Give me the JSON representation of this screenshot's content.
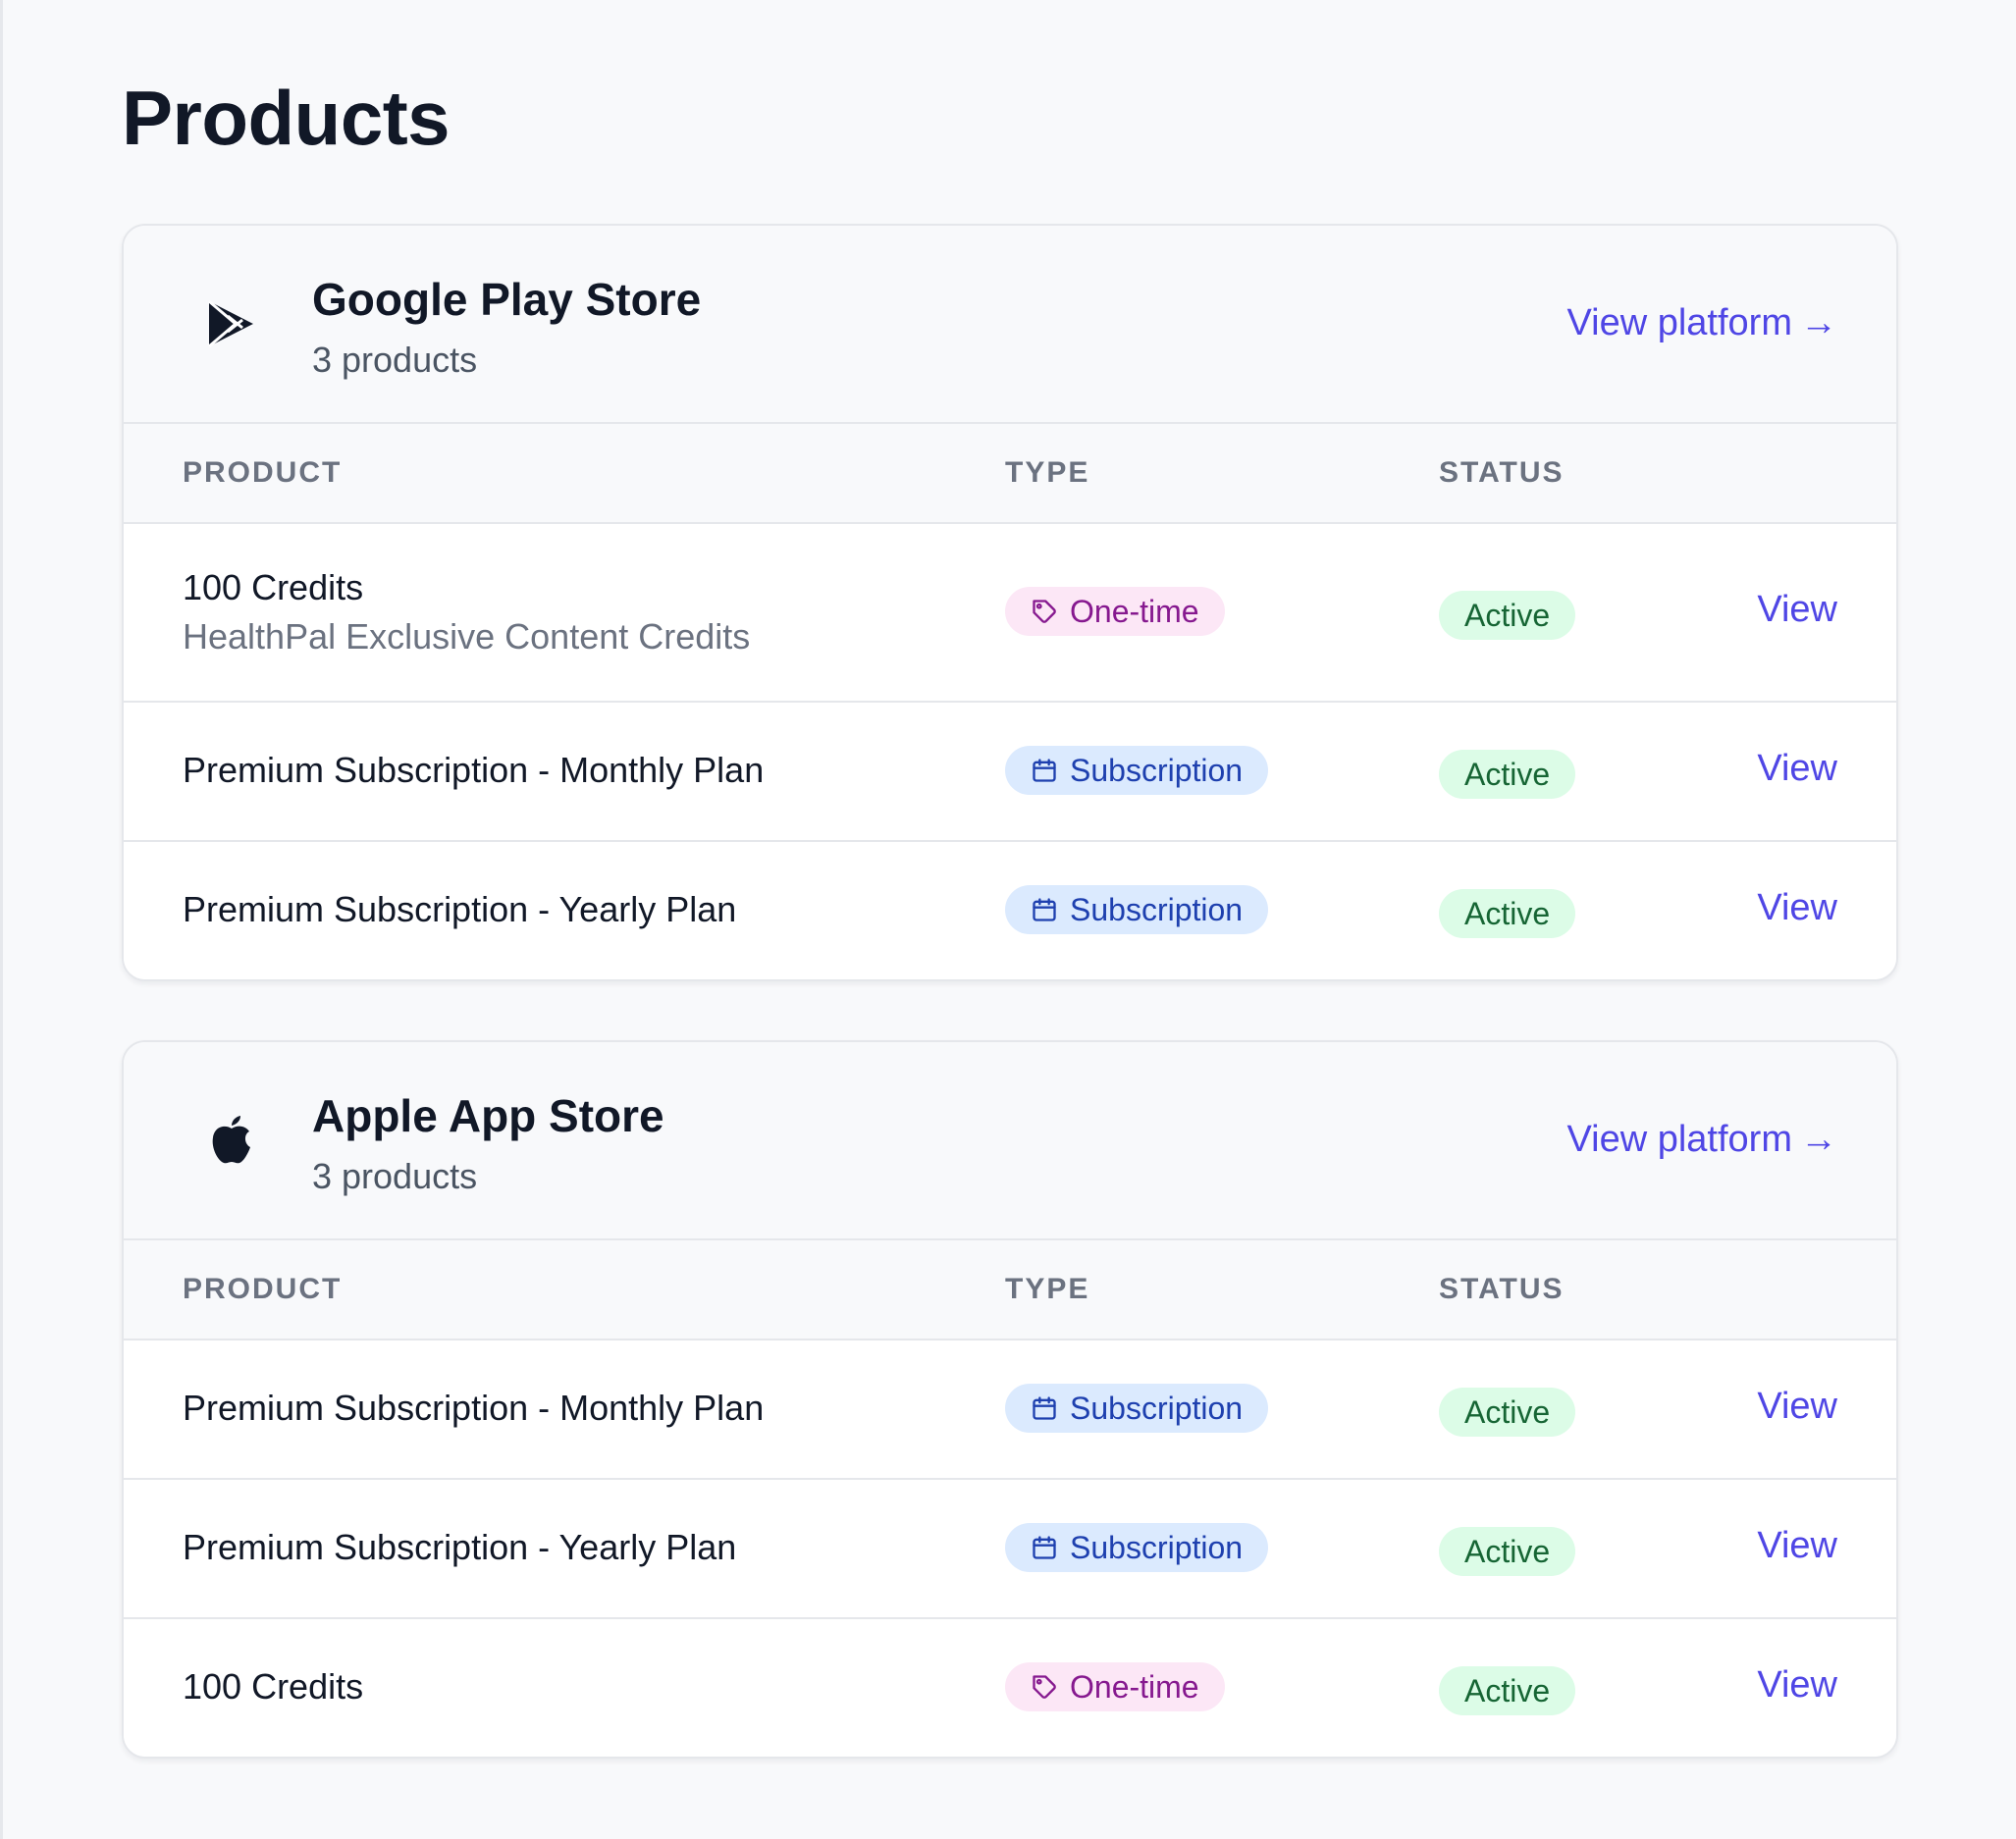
{
  "page": {
    "title": "Products"
  },
  "platforms": [
    {
      "name": "Google Play Store",
      "count": "3 products",
      "view_label": "View platform",
      "arrow": "→",
      "icon": "google-play-icon",
      "columns": [
        "PRODUCT",
        "TYPE",
        "STATUS"
      ],
      "rows": [
        {
          "name": "100 Credits",
          "description": "HealthPal Exclusive Content Credits",
          "type": "One-time",
          "status": "Active",
          "action": "View"
        },
        {
          "name": "Premium Subscription - Monthly Plan",
          "type": "Subscription",
          "status": "Active",
          "action": "View"
        },
        {
          "name": "Premium Subscription - Yearly Plan",
          "type": "Subscription",
          "status": "Active",
          "action": "View"
        }
      ]
    },
    {
      "name": "Apple App Store",
      "count": "3 products",
      "view_label": "View platform",
      "arrow": "→",
      "icon": "apple-icon",
      "columns": [
        "PRODUCT",
        "TYPE",
        "STATUS"
      ],
      "rows": [
        {
          "name": "Premium Subscription - Monthly Plan",
          "type": "Subscription",
          "status": "Active",
          "action": "View"
        },
        {
          "name": "Premium Subscription - Yearly Plan",
          "type": "Subscription",
          "status": "Active",
          "action": "View"
        },
        {
          "name": "100 Credits",
          "type": "One-time",
          "status": "Active",
          "action": "View"
        }
      ]
    }
  ],
  "colors": {
    "accent": "#4f46e5",
    "onetime_bg": "#fce7f6",
    "onetime_text": "#86198f",
    "subscription_bg": "#dbeafe",
    "subscription_text": "#1e40af",
    "active_bg": "#dcfce7",
    "active_text": "#166534"
  }
}
